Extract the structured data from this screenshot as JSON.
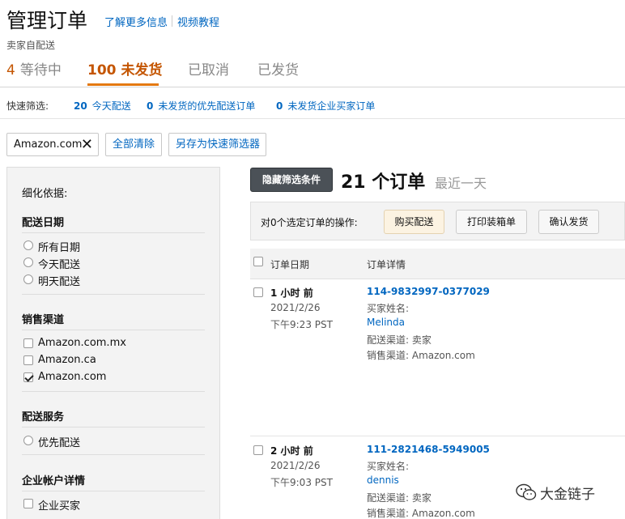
{
  "header": {
    "title": "管理订单",
    "help_link": "了解更多信息",
    "video_link": "视频教程",
    "subtitle": "卖家自配送"
  },
  "tabs": [
    {
      "count": "4",
      "label": "等待中",
      "active": false
    },
    {
      "count": "100",
      "label": "未发货",
      "active": true
    },
    {
      "count": "",
      "label": "已取消",
      "active": false
    },
    {
      "count": "",
      "label": "已发货",
      "active": false
    }
  ],
  "quick_filters": {
    "label": "快速筛选:",
    "items": [
      {
        "count": "20",
        "label": "今天配送"
      },
      {
        "count": "0",
        "label": "未发货的优先配送订单"
      },
      {
        "count": "0",
        "label": "未发货企业买家订单"
      }
    ]
  },
  "chips": {
    "active_filter": "Amazon.com",
    "clear_all": "全部清除",
    "save_as": "另存为快速筛选器"
  },
  "sidebar": {
    "refine_label": "细化依据:",
    "sections": [
      {
        "title": "配送日期",
        "type": "radio",
        "options": [
          {
            "label": "所有日期",
            "checked": false
          },
          {
            "label": "今天配送",
            "checked": false
          },
          {
            "label": "明天配送",
            "checked": false
          }
        ]
      },
      {
        "title": "销售渠道",
        "type": "checkbox",
        "options": [
          {
            "label": "Amazon.com.mx",
            "checked": false
          },
          {
            "label": "Amazon.ca",
            "checked": false
          },
          {
            "label": "Amazon.com",
            "checked": true
          }
        ]
      },
      {
        "title": "配送服务",
        "type": "radio",
        "options": [
          {
            "label": "优先配送",
            "checked": false
          }
        ]
      },
      {
        "title": "企业帐户详情",
        "type": "checkbox",
        "options": [
          {
            "label": "企业买家",
            "checked": false
          }
        ]
      }
    ]
  },
  "main": {
    "hide_filters_button": "隐藏筛选条件",
    "order_count": "21 个订单",
    "range": "最近一天",
    "action_label": "对0个选定订单的操作:",
    "actions": [
      "购买配送",
      "打印装箱单",
      "确认发货"
    ],
    "columns": [
      "订单日期",
      "订单详情"
    ]
  },
  "orders": [
    {
      "when": "1 小时 前",
      "date": "2021/2/26",
      "time": "下午9:23 PST",
      "order_id": "114-9832997-0377029",
      "buyer_label": "买家姓名:",
      "buyer": "Melinda",
      "fulfillment": "配送渠道: 卖家",
      "channel": "销售渠道: Amazon.com"
    },
    {
      "when": "2 小时 前",
      "date": "2021/2/26",
      "time": "下午9:03 PST",
      "order_id": "111-2821468-5949005",
      "buyer_label": "买家姓名:",
      "buyer": "dennis",
      "fulfillment": "配送渠道: 卖家",
      "channel": "销售渠道: Amazon.com"
    }
  ],
  "watermark": {
    "text": "大金链子",
    "icon": "wechat-icon"
  },
  "colors": {
    "accent_orange": "#c45500",
    "tab_underline": "#e47911",
    "link_blue": "#0066c0",
    "dark_button": "#4b5157"
  }
}
